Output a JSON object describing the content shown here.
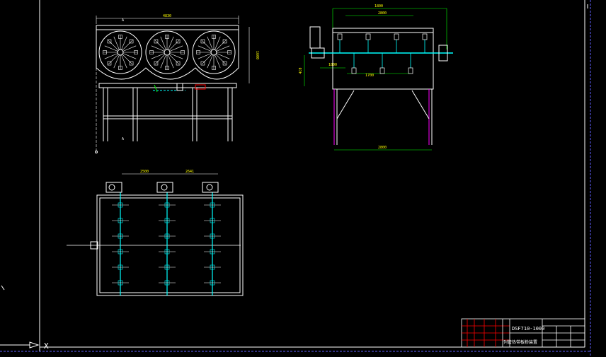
{
  "drawing": {
    "number": "DSF710-1000",
    "name": "列管热带板粉装置",
    "axis_x_label": "X",
    "section_mark": "A"
  },
  "front_view": {
    "overall_width": "4830",
    "overall_height": "1600"
  },
  "side_view": {
    "overall_width": "1800",
    "inner_width": "2800",
    "drive_width": "1800",
    "shaft_span": "1700",
    "offset": "4C0",
    "base_width": "2800"
  },
  "plan_view": {
    "pitch_1": "2500",
    "pitch_2": "2641"
  },
  "colors": {
    "background": "#000000",
    "line": "#ffffff",
    "cyan": "#00ffff",
    "green": "#00ff00",
    "magenta": "#ff00ff",
    "red": "#ff0000",
    "yellow": "#ffff00",
    "blue": "#3060ff"
  }
}
